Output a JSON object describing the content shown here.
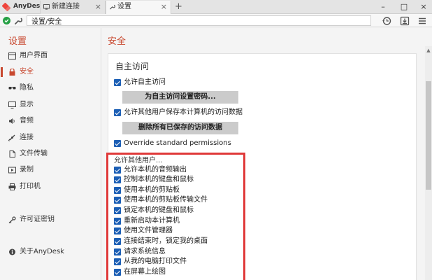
{
  "titlebar": {
    "app_name": "AnyDesk",
    "tabs": [
      {
        "label": "新建连接",
        "close": "×"
      },
      {
        "label": "设置",
        "close": "×"
      }
    ],
    "add_tab": "+",
    "minimize": "–",
    "maximize": "□",
    "close": "×"
  },
  "addressbar": {
    "value": "设置/安全"
  },
  "sidebar": {
    "title": "设置",
    "items": [
      {
        "label": "用户界面"
      },
      {
        "label": "安全"
      },
      {
        "label": "隐私"
      },
      {
        "label": "显示"
      },
      {
        "label": "音频"
      },
      {
        "label": "连接"
      },
      {
        "label": "文件传输"
      },
      {
        "label": "录制"
      },
      {
        "label": "打印机"
      },
      {
        "label": "许可证密钥"
      },
      {
        "label": "关于AnyDesk"
      }
    ]
  },
  "main": {
    "title": "安全",
    "panel_title": "自主访问",
    "allow_self_access": "允许自主访问",
    "set_password_button": "为自主访问设置密码...",
    "allow_other_users_save": "允许其他用户保存本计算机的访问数据",
    "delete_saved_button": "删除所有已保存的访问数据",
    "override_permissions": "Override standard permissions",
    "allow_others_label": "允许其他用户...",
    "permissions": [
      "允许本机的音频输出",
      "控制本机的键盘和鼠标",
      "使用本机的剪贴板",
      "使用本机的剪贴板传输文件",
      "锁定本机的键盘和鼠标",
      "重新启动本计算机",
      "使用文件管理器",
      "连接结束时，锁定我的桌面",
      "请求系统信息",
      "从我的电脑打印文件",
      "在屏幕上绘图"
    ]
  },
  "colors": {
    "accent": "#c8482f",
    "checkbox": "#1c5fb5",
    "highlight_box": "#e03a3a",
    "status_online": "#26a145"
  }
}
